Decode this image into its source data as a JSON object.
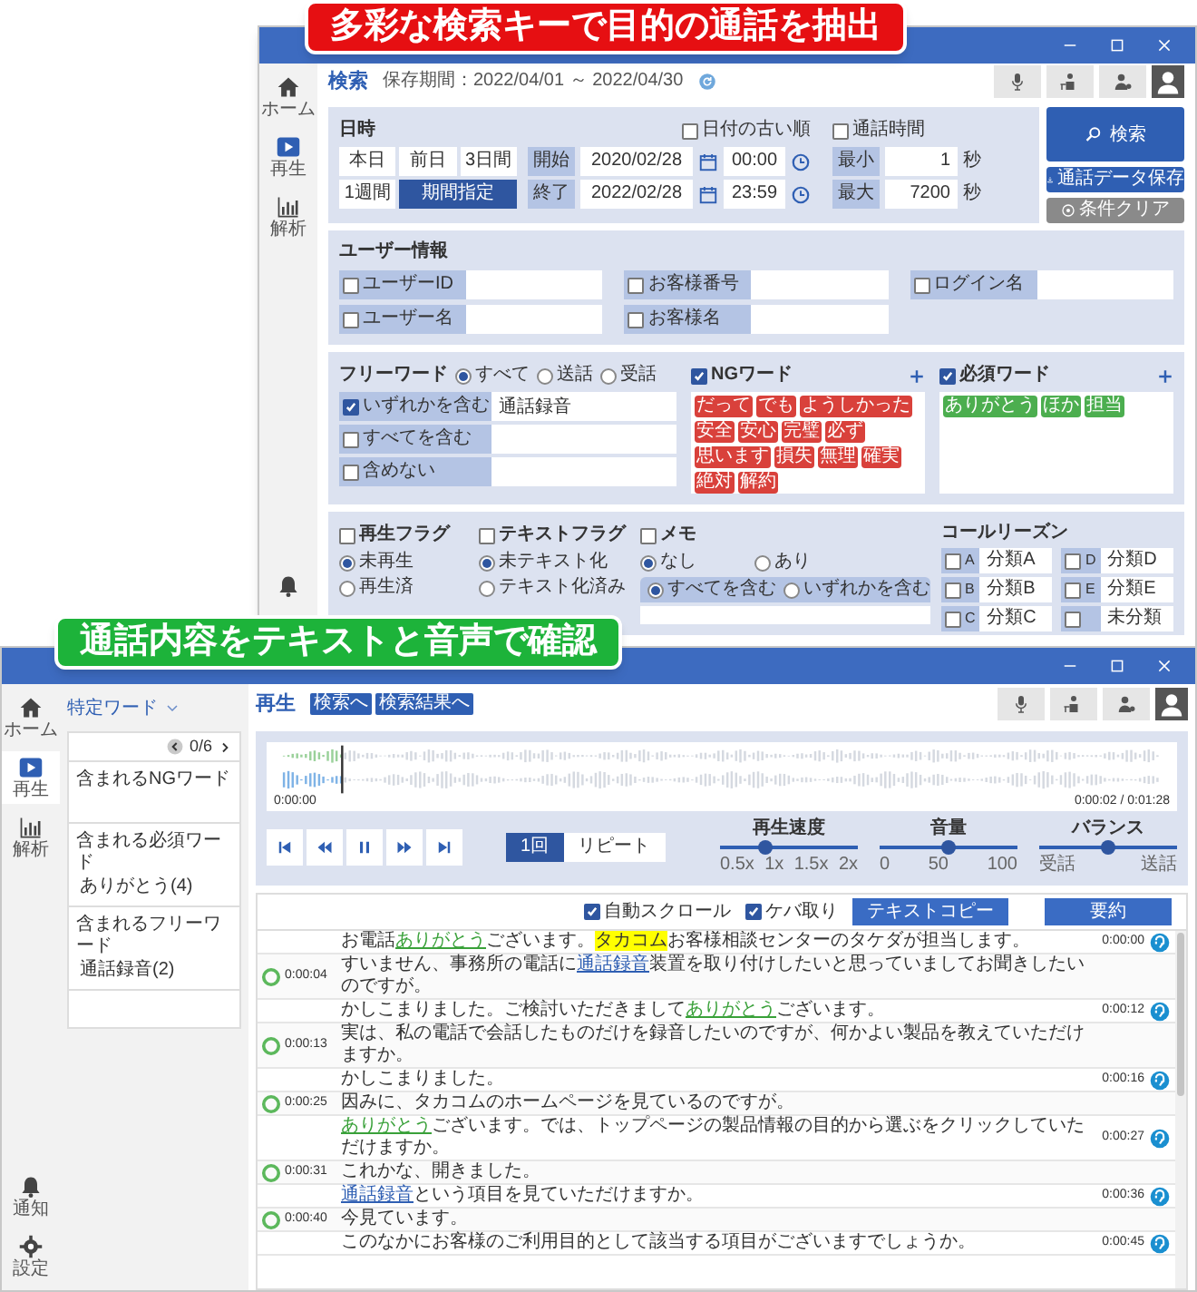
{
  "banners": [
    {
      "text": "多彩な検索キーで目的の通話を抽出",
      "color": "#e60f12"
    },
    {
      "text": "通話内容をテキストと音声で確認",
      "color": "#1db33a"
    }
  ],
  "search_window": {
    "sidebar": [
      {
        "kind": "home",
        "label": "ホーム",
        "selected": false
      },
      {
        "kind": "play",
        "label": "再生",
        "selected": false
      },
      {
        "kind": "chart",
        "label": "解析",
        "selected": false
      },
      {
        "kind": "bell",
        "selected": false
      }
    ],
    "title": "検索",
    "retention": "保存期間：2022/04/01 ～ 2022/04/30",
    "datetime": {
      "label": "日時",
      "oldest_first": {
        "label": "日付の古い順",
        "checked": false
      },
      "presets": [
        {
          "label": "本日",
          "selected": false
        },
        {
          "label": "前日",
          "selected": false
        },
        {
          "label": "3日間",
          "selected": false
        },
        {
          "label": "1週間",
          "selected": false
        },
        {
          "label": "期間指定",
          "selected": true
        }
      ],
      "range": [
        {
          "label": "開始",
          "date": "2020/02/28",
          "time": "00:00"
        },
        {
          "label": "終了",
          "date": "2022/02/28",
          "time": "23:59"
        }
      ]
    },
    "duration": {
      "label": "通話時間",
      "checked": false,
      "limits": [
        {
          "label": "最小",
          "value": "1",
          "unit": "秒"
        },
        {
          "label": "最大",
          "value": "7200",
          "unit": "秒"
        }
      ]
    },
    "actions": [
      {
        "kind": "primary",
        "label": "検索"
      },
      {
        "kind": "save",
        "label": "通話データ保存"
      },
      {
        "kind": "clear",
        "label": "条件クリア"
      }
    ],
    "user_info": {
      "title": "ユーザー情報",
      "rows": [
        [
          {
            "label": "ユーザーID",
            "checked": false
          },
          {
            "label": "お客様番号",
            "checked": false
          },
          {
            "label": "ログイン名",
            "checked": false
          }
        ],
        [
          {
            "label": "ユーザー名",
            "checked": false
          },
          {
            "label": "お客様名",
            "checked": false
          }
        ]
      ]
    },
    "free_word": {
      "title": "フリーワード",
      "targets": [
        {
          "label": "すべて",
          "selected": true
        },
        {
          "label": "送話",
          "selected": false
        },
        {
          "label": "受話",
          "selected": false
        }
      ],
      "conditions": [
        {
          "label": "いずれかを含む",
          "checked": true,
          "value": "通話録音"
        },
        {
          "label": "すべてを含む",
          "checked": false
        },
        {
          "label": "含めない",
          "checked": false
        }
      ]
    },
    "word_lists": [
      {
        "kind": "ng",
        "title": "NGワード",
        "checked": true,
        "tags": [
          "だって",
          "でも",
          "ようしかった",
          "安全",
          "安心",
          "完璧",
          "必ず",
          "思います",
          "損失",
          "無理",
          "確実",
          "絶対",
          "解約"
        ]
      },
      {
        "kind": "required",
        "title": "必須ワード",
        "checked": true,
        "tags": [
          "ありがとう",
          "ほか",
          "担当"
        ]
      }
    ],
    "flags": [
      {
        "title": "再生フラグ",
        "checked": false,
        "options": [
          {
            "label": "未再生",
            "selected": true
          },
          {
            "label": "再生済",
            "selected": false
          }
        ]
      },
      {
        "title": "テキストフラグ",
        "checked": false,
        "options": [
          {
            "label": "未テキスト化",
            "selected": true
          },
          {
            "label": "テキスト化済み",
            "selected": false
          }
        ]
      }
    ],
    "memo": {
      "title": "メモ",
      "checked": false,
      "options": [
        {
          "label": "なし",
          "selected": true
        },
        {
          "label": "あり",
          "selected": false
        }
      ],
      "match": [
        {
          "label": "すべてを含む",
          "selected": true
        },
        {
          "label": "いずれかを含む",
          "selected": false
        }
      ]
    },
    "call_reasons": {
      "title": "コールリーズン",
      "items": [
        {
          "code": "A",
          "label": "分類A",
          "checked": false
        },
        {
          "code": "D",
          "label": "分類D",
          "checked": false
        },
        {
          "code": "B",
          "label": "分類B",
          "checked": false
        },
        {
          "code": "E",
          "label": "分類E",
          "checked": false
        },
        {
          "code": "C",
          "label": "分類C",
          "checked": false
        },
        {
          "label": "未分類",
          "checked": false
        }
      ]
    }
  },
  "playback_window": {
    "sidebar": [
      {
        "kind": "home",
        "label": "ホーム",
        "selected": false
      },
      {
        "kind": "play",
        "label": "再生",
        "selected": true
      },
      {
        "kind": "chart",
        "label": "解析",
        "selected": false
      },
      {
        "kind": "bell",
        "label": "通知",
        "selected": false
      },
      {
        "kind": "gear",
        "label": "設定",
        "selected": false
      }
    ],
    "keyword_panel": {
      "title": "特定ワード",
      "counter": "0/6",
      "groups": [
        {
          "title": "含まれるNGワード"
        },
        {
          "title": "含まれる必須ワード",
          "detail": "ありがとう(4)"
        },
        {
          "title": "含まれるフリーワード",
          "detail": "通話録音(2)"
        }
      ]
    },
    "title": "再生",
    "links": [
      "検索へ",
      "検索結果へ"
    ],
    "player": {
      "start": "0:00:00",
      "position": "0:00:02 / 0:01:28",
      "repeat": [
        {
          "label": "1回",
          "selected": true
        },
        {
          "label": "リピート",
          "selected": false
        }
      ],
      "sliders": [
        {
          "label": "再生速度",
          "level": 0.33,
          "ticks": [
            "0.5x",
            "1x",
            "1.5x",
            "2x"
          ]
        },
        {
          "label": "音量",
          "level": 0.5,
          "ticks": [
            "0",
            "50",
            "100"
          ]
        },
        {
          "label": "バランス",
          "level": 0.5,
          "ticks": [
            "受話",
            "送話"
          ]
        }
      ]
    },
    "transcript": {
      "options": [
        {
          "label": "自動スクロール",
          "checked": true
        },
        {
          "label": "ケバ取り",
          "checked": true
        }
      ],
      "buttons": [
        {
          "label": "テキストコピー"
        },
        {
          "label": "要約"
        }
      ],
      "rows": [
        {
          "kind": "operator",
          "time": "0:00:00",
          "segments": [
            {
              "text": "お電話"
            },
            {
              "text": "ありがとう",
              "kind": "required"
            },
            {
              "text": "ございます。"
            },
            {
              "text": "タカコム",
              "kind": "highlight"
            },
            {
              "text": "お客様相談センターのタケダが担当します。"
            }
          ]
        },
        {
          "kind": "customer",
          "time": "0:00:04",
          "segments": [
            {
              "text": "すいません、事務所の電話に"
            },
            {
              "text": "通話録音",
              "kind": "free"
            },
            {
              "text": "装置を取り付けしたいと思っていましてお聞きしたいのですが。"
            }
          ]
        },
        {
          "kind": "operator",
          "time": "0:00:12",
          "segments": [
            {
              "text": "かしこまりました。ご検討いただきまして"
            },
            {
              "text": "ありがとう",
              "kind": "required"
            },
            {
              "text": "ございます。"
            }
          ]
        },
        {
          "kind": "customer",
          "time": "0:00:13",
          "segments": [
            {
              "text": "実は、私の電話で会話したものだけを録音したいのですが、何かよい製品を教えていただけますか。"
            }
          ]
        },
        {
          "kind": "operator",
          "time": "0:00:16",
          "segments": [
            {
              "text": "かしこまりました。"
            }
          ]
        },
        {
          "kind": "customer",
          "time": "0:00:25",
          "segments": [
            {
              "text": "因みに、タカコムのホームページを見ているのですが。"
            }
          ]
        },
        {
          "kind": "operator",
          "time": "0:00:27",
          "segments": [
            {
              "text": "ありがとう",
              "kind": "required"
            },
            {
              "text": "ございます。では、トップページの製品情報の目的から選ぶをクリックしていただけますか。"
            }
          ]
        },
        {
          "kind": "customer",
          "time": "0:00:31",
          "segments": [
            {
              "text": "これかな、開きました。"
            }
          ]
        },
        {
          "kind": "operator",
          "time": "0:00:36",
          "segments": [
            {
              "text": "通話録音",
              "kind": "free"
            },
            {
              "text": "という項目を見ていただけますか。"
            }
          ]
        },
        {
          "kind": "customer",
          "time": "0:00:40",
          "segments": [
            {
              "text": "今見ています。"
            }
          ]
        },
        {
          "kind": "operator",
          "time": "0:00:45",
          "segments": [
            {
              "text": "このなかにお客様のご利用目的として該当する項目がございますでしょうか。"
            }
          ]
        }
      ]
    }
  }
}
